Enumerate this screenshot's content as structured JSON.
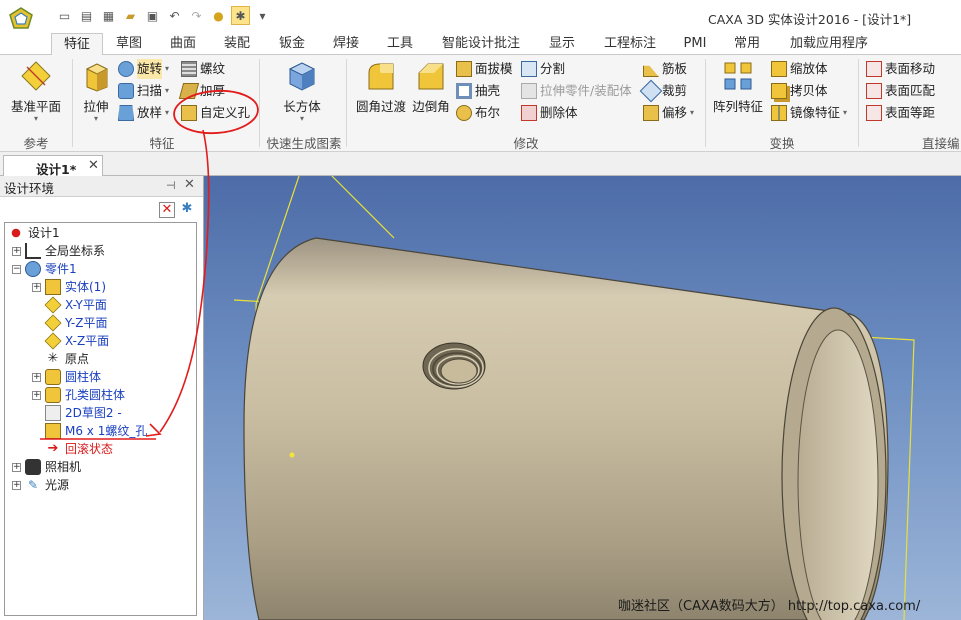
{
  "window": {
    "title": "CAXA 3D 实体设计2016 - [设计1*]"
  },
  "quick_access": [
    "new-icon",
    "open-icon",
    "doc-icon",
    "folder-icon",
    "save-icon",
    "undo-icon",
    "redo-icon",
    "bulb-icon",
    "design-icon",
    "dropdown-icon"
  ],
  "ribbon_tabs": [
    {
      "label": "特征",
      "active": true
    },
    {
      "label": "草图"
    },
    {
      "label": "曲面"
    },
    {
      "label": "装配"
    },
    {
      "label": "钣金"
    },
    {
      "label": "焊接"
    },
    {
      "label": "工具"
    },
    {
      "label": "智能设计批注"
    },
    {
      "label": "显示"
    },
    {
      "label": "工程标注"
    },
    {
      "label": "PMI"
    },
    {
      "label": "常用"
    },
    {
      "label": "加载应用程序"
    }
  ],
  "ribbon": {
    "ref_group": {
      "label": "参考",
      "datum_plane": "基准平面"
    },
    "feature_group": {
      "label": "特征",
      "extrude": "拉伸",
      "revolve": "旋转",
      "sweep": "扫描",
      "loft": "放样",
      "thread": "螺纹",
      "thicken": "加厚",
      "custom_hole": "自定义孔"
    },
    "quick_gen_group": {
      "label": "快速生成图素",
      "box": "长方体"
    },
    "modify_group": {
      "label": "修改",
      "fillet": "圆角过渡",
      "chamfer": "边倒角",
      "draft": "面拔模",
      "shell": "抽壳",
      "boolean": "布尔",
      "split": "分割",
      "extrude_part": "拉伸零件/装配体",
      "delete_body": "删除体",
      "rib": "筋板",
      "trim": "裁剪",
      "offset": "偏移"
    },
    "transform_group": {
      "label": "变换",
      "pattern": "阵列特征",
      "scale": "缩放体",
      "copy": "拷贝体",
      "mirror": "镜像特征"
    },
    "direct_edit_group": {
      "label": "直接编",
      "move_face": "表面移动",
      "match_face": "表面匹配",
      "equal_face": "表面等距"
    }
  },
  "document_tab": {
    "label": "设计1*"
  },
  "panel": {
    "title": "设计环境",
    "tree": [
      {
        "label": "设计1",
        "color": "normal"
      },
      {
        "label": "全局坐标系",
        "color": "normal"
      },
      {
        "label": "零件1",
        "color": "blue"
      },
      {
        "label": "实体(1)",
        "color": "blue"
      },
      {
        "label": "X-Y平面",
        "color": "blue"
      },
      {
        "label": "Y-Z平面",
        "color": "blue"
      },
      {
        "label": "X-Z平面",
        "color": "blue"
      },
      {
        "label": "原点",
        "color": "normal"
      },
      {
        "label": "圆柱体",
        "color": "blue"
      },
      {
        "label": "孔类圆柱体",
        "color": "blue"
      },
      {
        "label": "2D草图2 -",
        "color": "blue"
      },
      {
        "label": "M6 x 1螺纹_孔",
        "color": "blue"
      },
      {
        "label": "回滚状态",
        "color": "red"
      },
      {
        "label": "照相机",
        "color": "normal"
      },
      {
        "label": "光源",
        "color": "normal"
      }
    ]
  },
  "footer": {
    "credit": "咖迷社区（CAXA数码大方） http://top.caxa.com/"
  },
  "colors": {
    "accent": "#1f6fcf",
    "annotation": "#e31b1b",
    "tree_blue": "#1a3fbf",
    "viewport_top": "#4d6ca8"
  }
}
